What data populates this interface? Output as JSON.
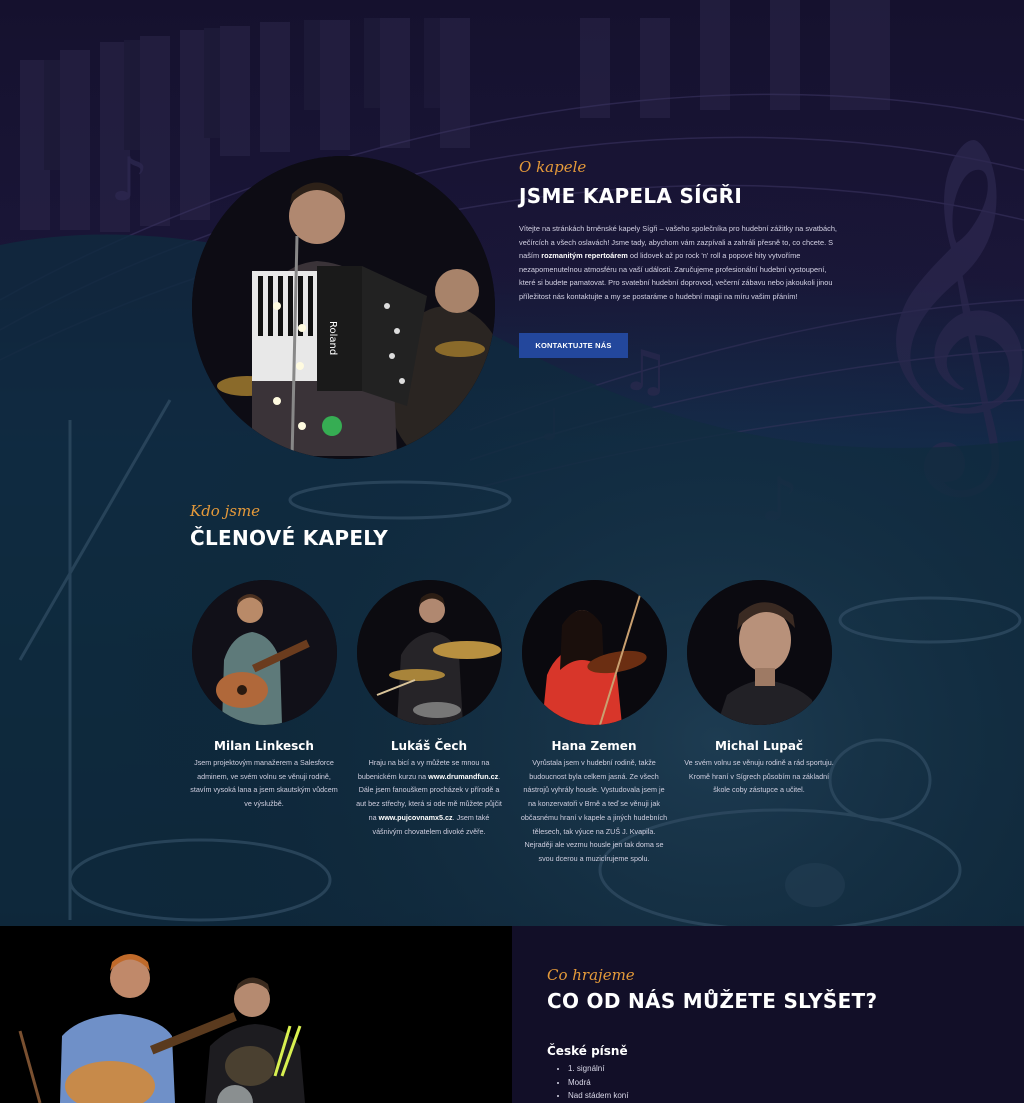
{
  "about": {
    "eyebrow": "O kapele",
    "title": "JSME KAPELA SÍGŘI",
    "text_1": "Vítejte na stránkách brněnské kapely Sígři – vašeho společníka pro hudební zážitky na svatbách, večírcích a všech oslavách! Jsme tady, abychom vám zazpívali a zahráli přesně to, co chcete. S naším ",
    "text_bold": "rozmanitým repertoárem",
    "text_2": " od lidovek až po rock 'n' roll a popové hity vytvoříme nezapomenutelnou atmosféru na vaší události. Zaručujeme profesionální hudební vystoupení, které si budete pamatovat. Pro svatební hudební doprovod, večerní zábavu nebo jakoukoli jinou příležitost nás kontaktujte a my se postaráme o hudební magii na míru vašim přáním!",
    "button": "KONTAKTUJTE NÁS"
  },
  "members_section": {
    "eyebrow": "Kdo jsme",
    "title": "ČLENOVÉ KAPELY"
  },
  "members": [
    {
      "name": "Milan Linkesch",
      "bio": "Jsem projektovým manažerem a Salesforce adminem, ve svém volnu se věnuji rodině, stavím vysoká lana a jsem skautským vůdcem ve výslužbě."
    },
    {
      "name": "Lukáš Čech",
      "bio_1": "Hraju na bicí a vy můžete se mnou na bubenickém kurzu na ",
      "link_1": "www.drumandfun.cz",
      "bio_2": ". Dále jsem fanouškem procházek v přírodě a aut bez střechy, která si ode mě můžete půjčit na ",
      "link_2": "www.pujcovnamx5.cz",
      "bio_3": ". Jsem také vášnivým chovatelem divoké zvěře."
    },
    {
      "name": "Hana Zemen",
      "bio": "Vyrůstala jsem v hudební rodině, takže budoucnost byla celkem jasná. Ze všech nástrojů vyhrály housle. Vystudovala jsem je na konzervatoři v Brně a teď se věnuji jak občasnému hraní v kapele a jiných hudebních tělesech, tak výuce na ZUŠ J. Kvapila. Nejraději ale vezmu housle jen tak doma se svou dcerou a muzicírujeme spolu."
    },
    {
      "name": "Michal Lupač",
      "bio": "Ve svém volnu se věnuju rodině a rád sportuju. Kromě hraní v Sígrech působím na základní škole coby zástupce a učitel."
    }
  ],
  "listen": {
    "eyebrow": "Co hrajeme",
    "title": "CO OD NÁS MŮŽETE SLYŠET?",
    "songs_title": "České písně",
    "songs": [
      "1. signální",
      "Modrá",
      "Nad stádem koní"
    ]
  },
  "colors": {
    "accent": "#e59a3a",
    "button": "#23479c",
    "dark": "#120f28"
  }
}
